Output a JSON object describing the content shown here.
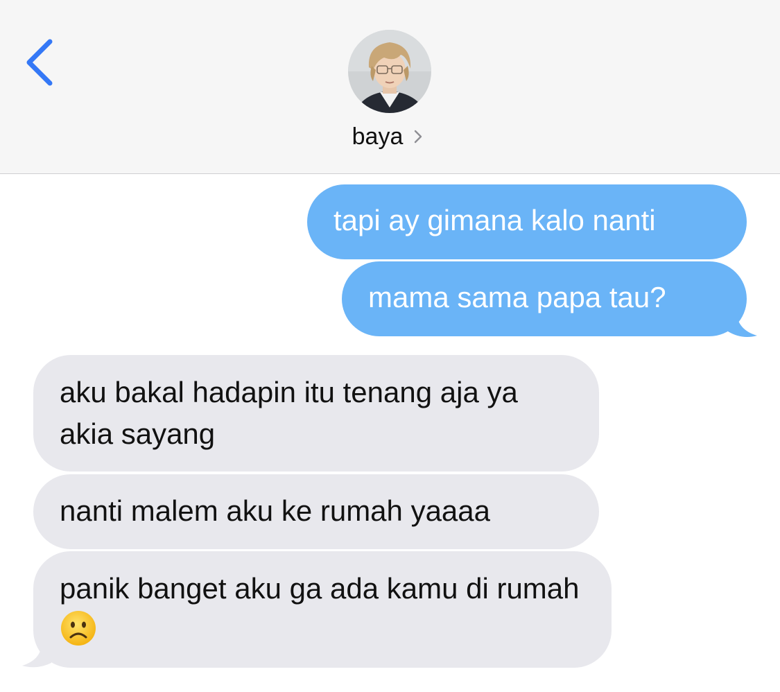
{
  "header": {
    "contact_name": "baya",
    "back_icon": "chevron-left-icon",
    "detail_icon": "chevron-right-icon",
    "accent_color": "#3478f6"
  },
  "messages": [
    {
      "direction": "outgoing",
      "text": "tapi ay gimana kalo nanti"
    },
    {
      "direction": "outgoing",
      "text": "mama sama papa tau?"
    },
    {
      "direction": "incoming",
      "text": "aku bakal hadapin itu tenang aja ya akia sayang"
    },
    {
      "direction": "incoming",
      "text": "nanti malem aku ke rumah yaaaa"
    },
    {
      "direction": "incoming",
      "text": "panik banget aku ga ada kamu di rumah",
      "emoji": "frowning-face-emoji"
    }
  ],
  "colors": {
    "outgoing_bubble": "#6ab4f7",
    "incoming_bubble": "#e8e8ed",
    "header_bg": "#f6f6f6"
  }
}
